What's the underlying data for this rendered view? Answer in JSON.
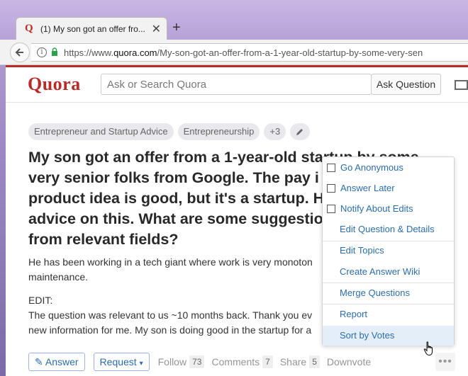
{
  "browser": {
    "tab_title": "(1) My son got an offer fro...",
    "tab_close": "✕",
    "new_tab": "+",
    "url_prefix": "https://www.",
    "url_domain": "quora.com",
    "url_rest": "/My-son-got-an-offer-from-a-1-year-old-startup-by-some-very-sen"
  },
  "header": {
    "logo": "Quora",
    "search_placeholder": "Ask or Search Quora",
    "ask_button": "Ask Question"
  },
  "topics": [
    "Entrepreneur and Startup Advice",
    "Entrepreneurship",
    "+3"
  ],
  "question": {
    "title": "My son got an offer from a 1-year-old startup by some very senior folks from Google. The pay is product idea is good, but it's a startup. H advice on this. What are some suggestio from relevant fields?",
    "title_lines": [
      "My son got an offer from a 1-year-old startup by some",
      "very senior folks from Google. The pay i",
      "product idea is good, but it's a startup. H",
      "advice on this. What are some suggestio",
      "from relevant fields?"
    ],
    "details_line1": "He has been working in a tech giant where work is very monoton",
    "details_line2": "maintenance.",
    "edit_label": "EDIT:",
    "edit_line1": "The question was relevant to us ~10 months back. Thank you ev",
    "edit_line2": "new information for me. My son is doing good in the startup for a"
  },
  "actions": {
    "answer": "Answer",
    "request": "Request",
    "follow": "Follow",
    "follow_count": "73",
    "comments": "Comments",
    "comments_count": "7",
    "share": "Share",
    "share_count": "5",
    "downvote": "Downvote",
    "more": "•••"
  },
  "menu": {
    "items": [
      "Go Anonymous",
      "Answer Later",
      "Notify About Edits",
      "Edit Question & Details",
      "Edit Topics",
      "Create Answer Wiki",
      "Merge Questions",
      "Report",
      "Sort by Votes"
    ]
  },
  "colors": {
    "brand": "#b92b27",
    "link": "#2b6dad",
    "hover": "#e4eef9"
  }
}
